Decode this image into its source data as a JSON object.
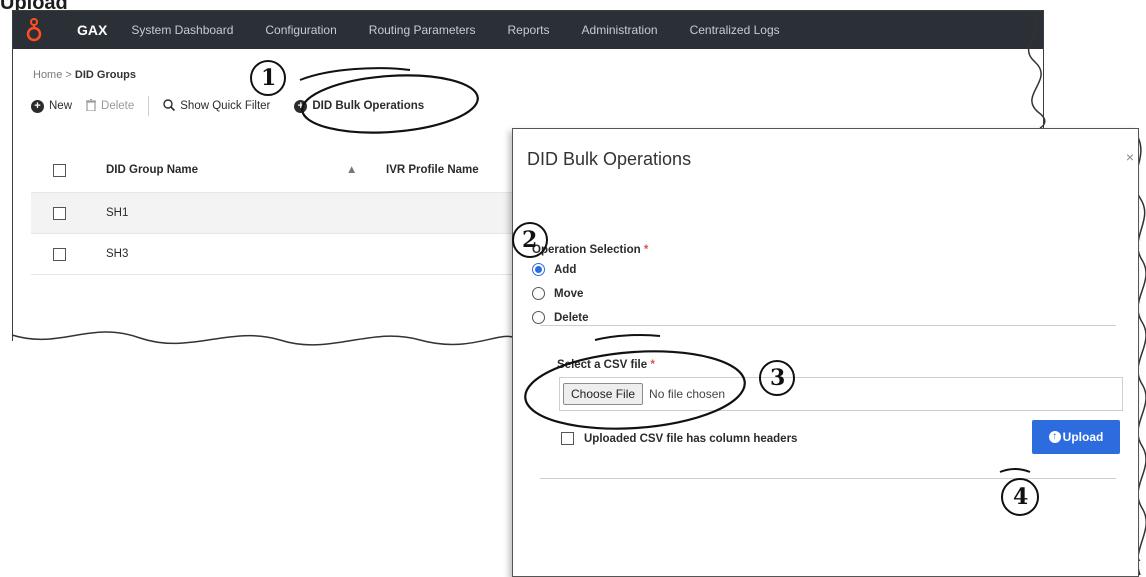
{
  "caption": "Upload",
  "navbar": {
    "brand": "GAX",
    "items": [
      "System Dashboard",
      "Configuration",
      "Routing Parameters",
      "Reports",
      "Administration",
      "Centralized Logs"
    ]
  },
  "breadcrumb": {
    "home": "Home",
    "separator": ">",
    "current": "DID Groups"
  },
  "toolbar": {
    "new_label": "New",
    "delete_label": "Delete",
    "quick_filter_label": "Show Quick Filter",
    "bulk_ops_label": "DID Bulk Operations"
  },
  "table": {
    "headers": {
      "name": "DID Group Name",
      "ivr": "IVR Profile Name"
    },
    "rows": [
      {
        "name": "SH1"
      },
      {
        "name": "SH3"
      }
    ]
  },
  "dialog": {
    "title": "DID Bulk Operations",
    "close": "×",
    "operation_label": "Operation Selection",
    "required_mark": "*",
    "options": [
      "Add",
      "Move",
      "Delete"
    ],
    "selected_option": "Add",
    "csv_label": "Select a CSV file",
    "choose_file_label": "Choose File",
    "no_file_text": "No file chosen",
    "headers_checkbox_label": "Uploaded CSV file has column headers",
    "upload_label": "Upload"
  },
  "annotations": [
    "1",
    "2",
    "3",
    "4"
  ],
  "colors": {
    "navbar": "#2b2f36",
    "primary": "#2d6cdf",
    "required": "#d9534f",
    "logo": "#ff4f1f"
  }
}
